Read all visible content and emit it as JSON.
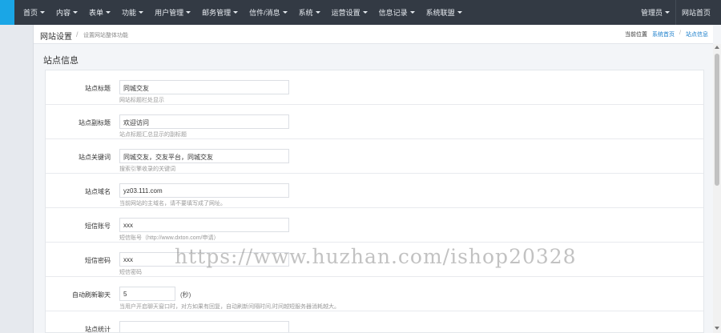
{
  "nav": {
    "items": [
      {
        "label": "首页",
        "name": "nav-item-home"
      },
      {
        "label": "内容",
        "name": "nav-item-content"
      },
      {
        "label": "表单",
        "name": "nav-item-forms"
      },
      {
        "label": "功能",
        "name": "nav-item-functions"
      },
      {
        "label": "用户管理",
        "name": "nav-item-users"
      },
      {
        "label": "邮务管理",
        "name": "nav-item-mail"
      },
      {
        "label": "信件/消息",
        "name": "nav-item-messages"
      },
      {
        "label": "系统",
        "name": "nav-item-system"
      },
      {
        "label": "运营设置",
        "name": "nav-item-operations"
      },
      {
        "label": "信息记录",
        "name": "nav-item-records"
      },
      {
        "label": "系统联盟",
        "name": "nav-item-alliance"
      }
    ],
    "admin_label": "管理员",
    "home_link_label": "网站首页"
  },
  "breadcrumb": {
    "title": "网站设置",
    "separator": "/",
    "description": "设置网站整体功能",
    "current_label": "当前位置",
    "link1": "系统首页",
    "slash": "/",
    "link2": "站点信息"
  },
  "panel": {
    "title": "站点信息"
  },
  "form": {
    "rows": [
      {
        "label": "站点标题",
        "value": "同城交友",
        "hint": "网站标题栏处显示"
      },
      {
        "label": "站点副标题",
        "value": "欢迎访问",
        "hint": "站点标题汇总显示的副标题"
      },
      {
        "label": "站点关键词",
        "value": "同城交友，交友平台，同城交友",
        "hint": "搜索引擎收录的关键词"
      },
      {
        "label": "站点域名",
        "value": "yz03.111.com",
        "hint": "当前网站的主域名，请不要填写成了网址。"
      },
      {
        "label": "短信账号",
        "value": "xxx",
        "hint": "短信账号（http://www.dxton.com/申请）"
      },
      {
        "label": "短信密码",
        "value": "xxx",
        "hint": "短信密码"
      },
      {
        "label": "自动刷新聊天",
        "value": "5",
        "unit": "(秒)",
        "hint": "当用户开启聊天窗口时，对方如果有回复，自动刷新间隔时间,时间越短服务器消耗越大。"
      },
      {
        "label": "站点统计",
        "value": "",
        "hint": ""
      }
    ]
  },
  "watermark": "https://www.huzhan.com/ishop20328",
  "colors": {
    "topbar": "#333a44",
    "accent": "#1aa6e6",
    "link": "#1a7ecb"
  }
}
